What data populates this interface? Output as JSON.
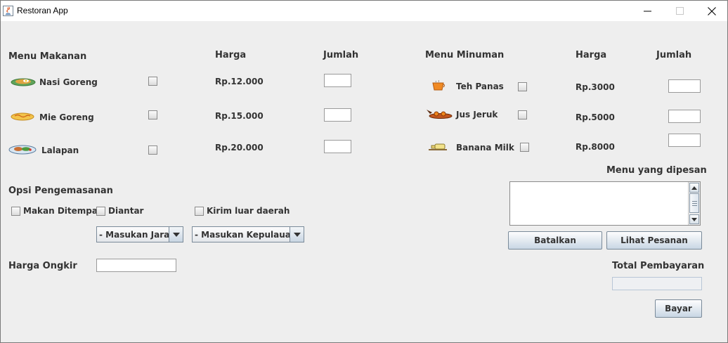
{
  "window": {
    "title": "Restoran App"
  },
  "food_menu": {
    "heading": "Menu Makanan",
    "price_header": "Harga",
    "qty_header": "Jumlah",
    "items": [
      {
        "name": "Nasi Goreng",
        "price": "Rp.12.000",
        "icon": "fried-rice-plate-icon"
      },
      {
        "name": "Mie Goreng",
        "price": "Rp.15.000",
        "icon": "fried-noodle-plate-icon"
      },
      {
        "name": "Lalapan",
        "price": "Rp.20.000",
        "icon": "lalapan-plate-icon"
      }
    ]
  },
  "drink_menu": {
    "heading": "Menu Minuman",
    "price_header": "Harga",
    "qty_header": "Jumlah",
    "items": [
      {
        "name": "Teh Panas",
        "price": "Rp.3000",
        "icon": "hot-tea-icon"
      },
      {
        "name": "Jus Jeruk",
        "price": "Rp.5000",
        "icon": "orange-juice-icon"
      },
      {
        "name": "Banana Milk",
        "price": "Rp.8000",
        "icon": "banana-milk-icon"
      }
    ]
  },
  "packaging": {
    "heading": "Opsi Pengemasanan",
    "options": [
      "Makan Ditempat",
      "Diantar",
      "Kirim luar daerah"
    ],
    "distance_select": "- Masukan Jara...",
    "island_select": "- Masukan Kepulauan -"
  },
  "shipping": {
    "label": "Harga Ongkir",
    "value": ""
  },
  "order_summary": {
    "heading": "Menu yang dipesan",
    "text": "",
    "cancel_label": "Batalkan",
    "view_label": "Lihat Pesanan"
  },
  "payment": {
    "heading": "Total Pembayaran",
    "total": "",
    "pay_label": "Bayar"
  }
}
